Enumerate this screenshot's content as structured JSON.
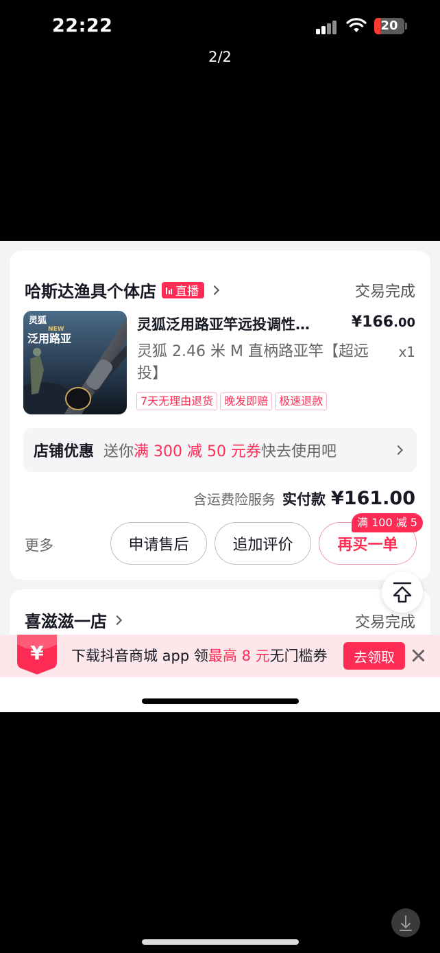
{
  "status_bar": {
    "time": "22:22",
    "battery": "20",
    "battery_level_pct": 20
  },
  "viewer": {
    "page_indicator": "2/2"
  },
  "order1": {
    "shop_name": "哈斯达渔具个体店",
    "live_badge": "直播",
    "status": "交易完成",
    "product": {
      "title": "灵狐泛用路亚竿远投调性…",
      "price_main": "¥166",
      "price_decimal": ".00",
      "spec": "灵狐 2.46 米 M 直柄路亚竿【超远投】",
      "qty": "x1",
      "image_text_brand": "灵狐",
      "image_text_new": "NEW",
      "image_text_caption": "泛用路亚",
      "tags": [
        "7天无理由退货",
        "晚发即赔",
        "极速退款"
      ]
    },
    "promo": {
      "label": "店铺优惠",
      "text_before": "送你",
      "text_highlight": "满 300 减 50 元券",
      "text_after": "快去使用吧"
    },
    "total": {
      "note": "含运费险服务",
      "label": "实付款",
      "amount": "¥161.00"
    },
    "actions": {
      "more": "更多",
      "after_sale": "申请售后",
      "add_review": "追加评价",
      "rebuy": "再买一单",
      "rebuy_badge": "满 100 减 5"
    }
  },
  "order2": {
    "shop_name": "喜滋滋一店",
    "status": "交易完成"
  },
  "banner": {
    "coupon_symbol": "¥",
    "text_before": "下载抖音商城 app 领",
    "text_highlight": "最高 8 元",
    "text_after": "无门槛券",
    "button": "去领取"
  },
  "colors": {
    "accent": "#fe2c55",
    "background": "#000000",
    "card": "#ffffff"
  }
}
